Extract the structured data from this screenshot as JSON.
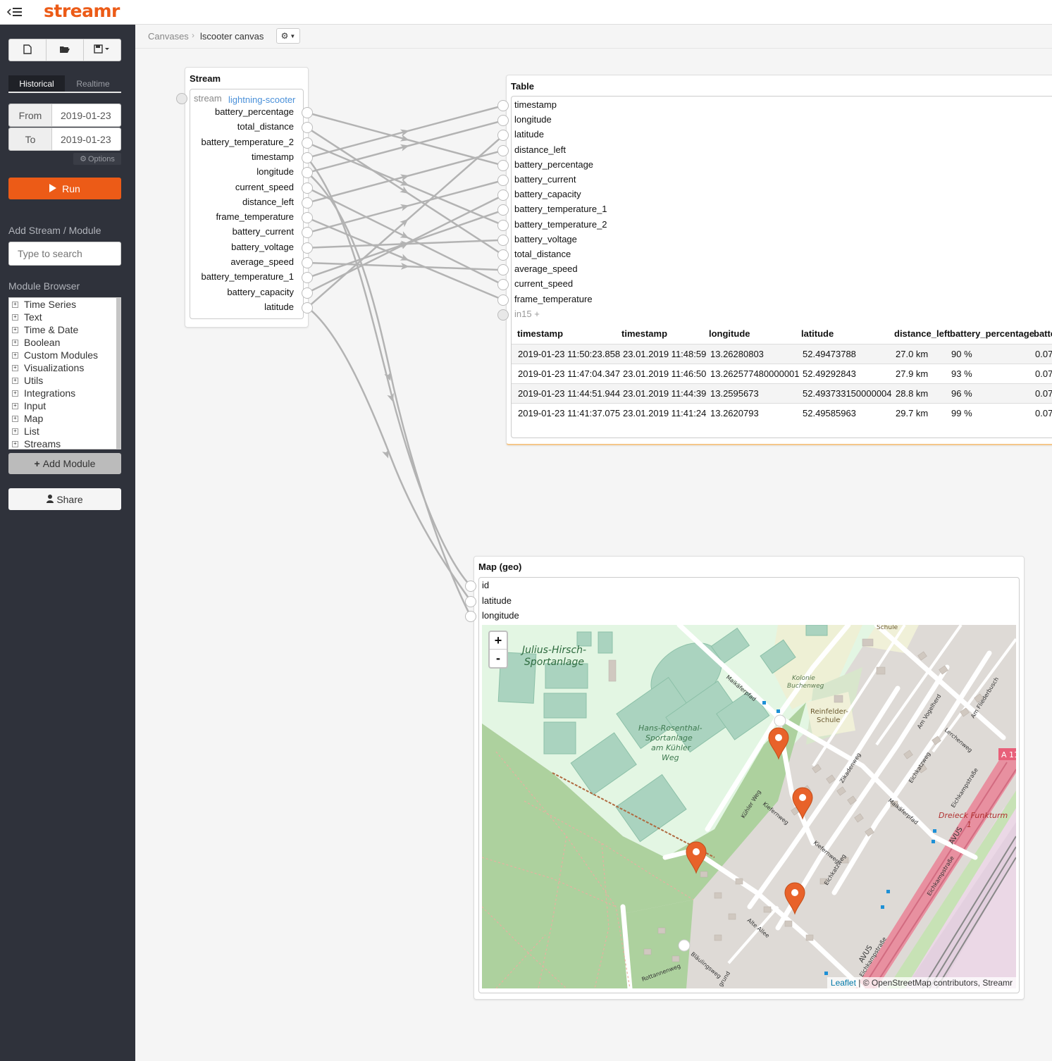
{
  "header": {
    "logo_text": "streamr",
    "menu_icon": "menu-collapse-icon",
    "brand_color": "#ec5b17"
  },
  "sidebar": {
    "toolbar": {
      "new_icon": "new-file-icon",
      "open_icon": "folder-open-icon",
      "save_icon": "save-dropdown-icon"
    },
    "tabs": {
      "historical": "Historical",
      "realtime": "Realtime"
    },
    "from_label": "From",
    "from_value": "2019-01-23",
    "to_label": "To",
    "to_value": "2019-01-23",
    "options_label": "Options",
    "run_label": "Run",
    "add_heading": "Add Stream / Module",
    "search_placeholder": "Type to search",
    "browser_heading": "Module Browser",
    "module_categories": [
      "Time Series",
      "Text",
      "Time & Date",
      "Boolean",
      "Custom Modules",
      "Visualizations",
      "Utils",
      "Integrations",
      "Input",
      "Map",
      "List",
      "Streams"
    ],
    "add_module_label": "Add Module",
    "share_label": "Share"
  },
  "breadcrumb": {
    "root": "Canvases",
    "separator": "›",
    "current": "lscooter canvas"
  },
  "stream_module": {
    "title": "Stream",
    "stream_label": "stream",
    "stream_name": "lightning-scooter",
    "outputs": [
      "battery_percentage",
      "total_distance",
      "battery_temperature_2",
      "timestamp",
      "longitude",
      "current_speed",
      "distance_left",
      "frame_temperature",
      "battery_current",
      "battery_voltage",
      "average_speed",
      "battery_temperature_1",
      "battery_capacity",
      "latitude"
    ]
  },
  "table_module": {
    "title": "Table",
    "inputs": [
      "timestamp",
      "longitude",
      "latitude",
      "distance_left",
      "battery_percentage",
      "battery_current",
      "battery_capacity",
      "battery_temperature_1",
      "battery_temperature_2",
      "battery_voltage",
      "total_distance",
      "average_speed",
      "current_speed",
      "frame_temperature"
    ],
    "extra_input": "in15",
    "columns": [
      "timestamp",
      "timestamp",
      "longitude",
      "latitude",
      "distance_left",
      "battery_percentage",
      "batte"
    ],
    "rows": [
      [
        "2019-01-23 11:50:23.858",
        "23.01.2019 11:48:59",
        "13.26280803",
        "52.49473788",
        "27.0 km",
        "90 %",
        "0.07"
      ],
      [
        "2019-01-23 11:47:04.347",
        "23.01.2019 11:46:50",
        "13.262577480000001",
        "52.49292843",
        "27.9 km",
        "93 %",
        "0.07"
      ],
      [
        "2019-01-23 11:44:51.944",
        "23.01.2019 11:44:39",
        "13.2595673",
        "52.493733150000004",
        "28.8 km",
        "96 %",
        "0.07"
      ],
      [
        "2019-01-23 11:41:37.075",
        "23.01.2019 11:41:24",
        "13.2620793",
        "52.49585963",
        "29.7 km",
        "99 %",
        "0.07"
      ]
    ]
  },
  "map_module": {
    "title": "Map (geo)",
    "inputs": [
      "id",
      "latitude",
      "longitude"
    ],
    "zoom_in": "+",
    "zoom_out": "-",
    "attribution_link": "Leaflet",
    "attribution_text": "| © OpenStreetMap contributors, Streamr",
    "labels": {
      "park1_l1": "Julius-Hirsch-",
      "park1_l2": "Sportanlage",
      "park2_l1": "Hans-Rosenthal-",
      "park2_l2": "Sportanlage",
      "park2_l3": "am Kühler",
      "park2_l4": "Weg",
      "kolonie_l1": "Kolonie",
      "kolonie_l2": "Buchenweg",
      "reinf_l1": "Reinfelder-",
      "reinf_l2": "Schule",
      "schule": "Schule",
      "dreieck_l1": "Dreieck Funkturm",
      "dreieck_l2": "1",
      "a11": "A 11",
      "avus1": "AVUS",
      "avus2": "AVUS",
      "s_maikaeferpfad": "Maikäferpfad",
      "s_maikaeferpfad2": "Maikäferpfad",
      "s_kuehlerweg": "Kühler Weg",
      "s_kiefernweg": "Kiefernweg",
      "s_kiefernweg2": "Kiefernweg",
      "s_zikadenweg": "Zikadenweg",
      "s_eichkatzweg": "Eichkatzweg",
      "s_eichkatzweg2": "Eichkatzweg",
      "s_amvogelherd": "Am Vogelherd",
      "s_amfliederbusch": "Am Fliederbusch",
      "s_lerchenweg": "Lerchenweg",
      "s_eichkampstr1": "Eichkampstraße",
      "s_eichkampstr2": "Eichkampstraße",
      "s_eichkampstr3": "Eichkampstraße",
      "s_altealle": "Alte Allee",
      "s_blaulingsweg": "Bläulingsweg",
      "s_rottannenweg": "Rottannenweg",
      "s_grund": "grund"
    },
    "marker_count": 4,
    "marker_color": "#e8622a"
  },
  "colors": {
    "sidebar_bg": "#2f323b",
    "accent": "#ec5b17",
    "link": "#4a90d9",
    "connection": "#b3b3b3"
  }
}
